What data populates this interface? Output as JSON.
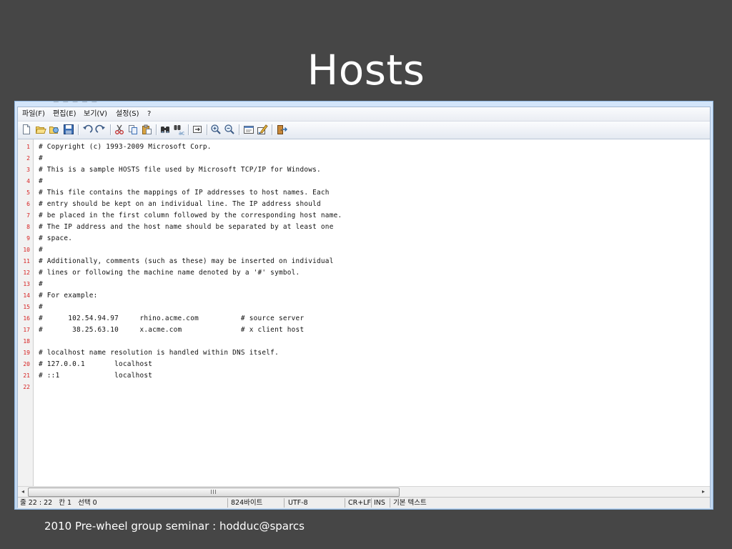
{
  "slide": {
    "title": "Hosts",
    "footer": "2010 Pre-wheel group seminar : hodduc@sparcs"
  },
  "menu": [
    "파일(F)",
    "편집(E)",
    "보기(V)",
    "설정(S)",
    "?"
  ],
  "toolbar_icons": [
    "new-file-icon",
    "open-folder-icon",
    "reload-icon",
    "save-icon",
    "undo-icon",
    "redo-icon",
    "cut-icon",
    "copy-icon",
    "paste-icon",
    "find-icon",
    "replace-icon",
    "goto-line-icon",
    "zoom-in-icon",
    "zoom-out-icon",
    "settings-icon",
    "edit-scheme-icon",
    "exit-icon"
  ],
  "editor": {
    "lines": [
      "# Copyright (c) 1993-2009 Microsoft Corp.",
      "#",
      "# This is a sample HOSTS file used by Microsoft TCP/IP for Windows.",
      "#",
      "# This file contains the mappings of IP addresses to host names. Each",
      "# entry should be kept on an individual line. The IP address should",
      "# be placed in the first column followed by the corresponding host name.",
      "# The IP address and the host name should be separated by at least one",
      "# space.",
      "#",
      "# Additionally, comments (such as these) may be inserted on individual",
      "# lines or following the machine name denoted by a '#' symbol.",
      "#",
      "# For example:",
      "#",
      "#      102.54.94.97     rhino.acme.com          # source server",
      "#       38.25.63.10     x.acme.com              # x client host",
      "",
      "# localhost name resolution is handled within DNS itself.",
      "# 127.0.0.1       localhost",
      "# ::1             localhost",
      ""
    ]
  },
  "scrollbar": {
    "left_arrow": "◂",
    "right_arrow": "▸"
  },
  "statusbar": {
    "position": "줄 22 : 22   칸 1   선택 0",
    "size": "824바이트",
    "encoding": "UTF-8",
    "eol": "CR+LF",
    "mode": "INS",
    "scheme": "기본 텍스트"
  },
  "colors": {
    "background": "#464646",
    "line_number": "#d62020",
    "window_frame": "#c2d8f1"
  }
}
